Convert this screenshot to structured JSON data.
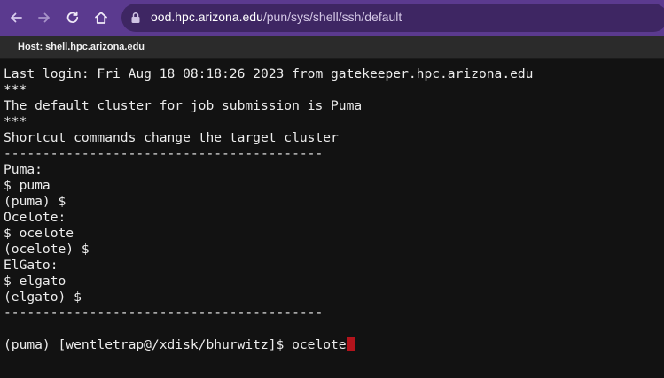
{
  "browser": {
    "url_host": "ood.hpc.arizona.edu",
    "url_path": "/pun/sys/shell/ssh/default",
    "back_icon": "arrow-left-icon",
    "forward_icon": "arrow-right-icon",
    "reload_icon": "reload-icon",
    "home_icon": "home-icon",
    "lock_icon": "lock-icon",
    "accent_color": "#5b3a8f"
  },
  "tab_strip": {
    "host_label": "Host: shell.hpc.arizona.edu"
  },
  "terminal": {
    "lines": [
      "Last login: Fri Aug 18 08:18:26 2023 from gatekeeper.hpc.arizona.edu",
      "***",
      "The default cluster for job submission is Puma",
      "***",
      "Shortcut commands change the target cluster",
      "-----------------------------------------",
      "Puma:",
      "$ puma",
      "(puma) $",
      "Ocelote:",
      "$ ocelote",
      "(ocelote) $",
      "ElGato:",
      "$ elgato",
      "(elgato) $",
      "-----------------------------------------",
      ""
    ],
    "prompt": "(puma) [wentletrap@/xdisk/bhurwitz]$ ",
    "current_input": "ocelote",
    "cursor_color": "#b3141c"
  }
}
